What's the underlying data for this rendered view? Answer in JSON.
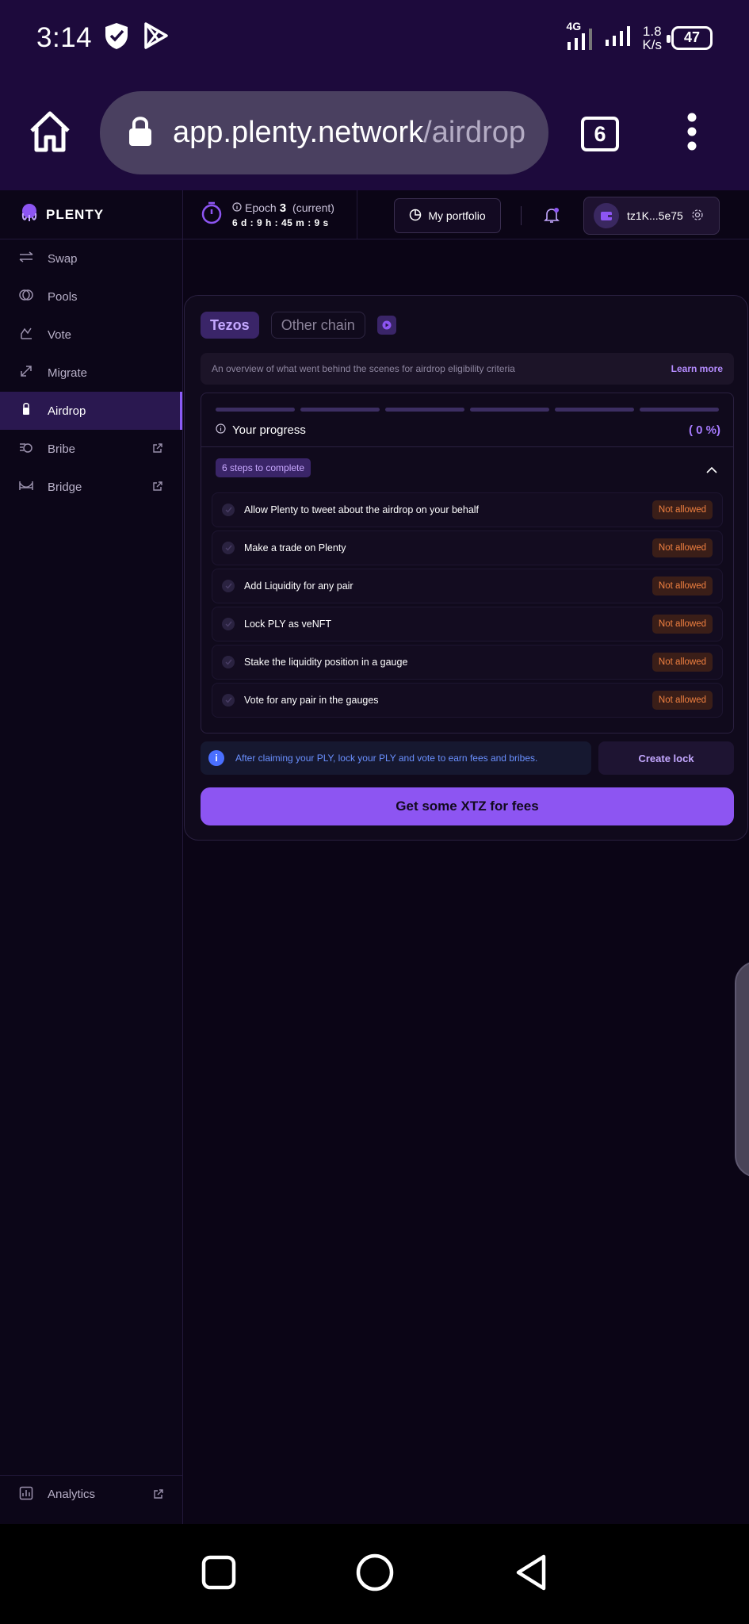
{
  "status_bar": {
    "time": "3:14",
    "network": "4G",
    "speed_value": "1.8",
    "speed_unit": "K/s",
    "battery": "47"
  },
  "browser": {
    "url_host": "app.plenty.network",
    "url_path": "/airdrop",
    "tab_count": "6"
  },
  "sidebar": {
    "logo": "PLENTY",
    "items": [
      {
        "label": "Swap",
        "icon": "swap-icon",
        "active": false,
        "external": false
      },
      {
        "label": "Pools",
        "icon": "pools-icon",
        "active": false,
        "external": false
      },
      {
        "label": "Vote",
        "icon": "vote-icon",
        "active": false,
        "external": false
      },
      {
        "label": "Migrate",
        "icon": "migrate-icon",
        "active": false,
        "external": false
      },
      {
        "label": "Airdrop",
        "icon": "airdrop-icon",
        "active": true,
        "external": false
      },
      {
        "label": "Bribe",
        "icon": "bribe-icon",
        "active": false,
        "external": true
      },
      {
        "label": "Bridge",
        "icon": "bridge-icon",
        "active": false,
        "external": true
      }
    ],
    "analytics": "Analytics"
  },
  "header": {
    "epoch_label": "Epoch",
    "epoch_number": "3",
    "epoch_state": "(current)",
    "countdown": "6 d : 9 h : 45 m : 9 s",
    "portfolio": "My portfolio",
    "wallet": "tz1K...5e75"
  },
  "airdrop": {
    "tabs": [
      "Tezos",
      "Other chain"
    ],
    "overview": "An overview of what went behind the scenes for airdrop eligibility criteria",
    "learn_more": "Learn more",
    "progress_title": "Your progress",
    "progress_pct": "( 0 %)",
    "progress_fraction": 0,
    "steps_badge": "6 steps to complete",
    "steps": [
      {
        "label": "Allow Plenty to tweet about the airdrop on your behalf",
        "status": "Not allowed"
      },
      {
        "label": "Make a trade on Plenty",
        "status": "Not allowed"
      },
      {
        "label": "Add Liquidity for any pair",
        "status": "Not allowed"
      },
      {
        "label": "Lock PLY as veNFT",
        "status": "Not allowed"
      },
      {
        "label": "Stake the liquidity position in a gauge",
        "status": "Not allowed"
      },
      {
        "label": "Vote for any pair in the gauges",
        "status": "Not allowed"
      }
    ],
    "info": "After claiming your PLY, lock your PLY and vote to earn fees and bribes.",
    "create_lock": "Create lock",
    "cta": "Get some XTZ for fees"
  },
  "colors": {
    "accent": "#8d55f2",
    "status_warn": "#f08040",
    "info": "#6a90ff",
    "bg": "#0b0516"
  }
}
